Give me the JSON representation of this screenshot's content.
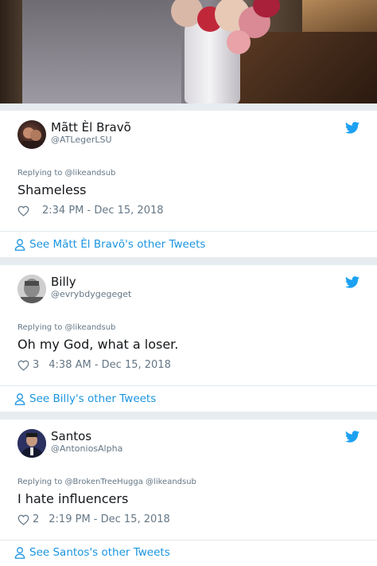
{
  "tweets": [
    {
      "name": "Mãtt Èl Bravõ",
      "handle": "@ATLegerLSU",
      "replying": "Replying to @likeandsub",
      "text": "Shameless",
      "likes": "",
      "time": "2:34 PM - Dec 15, 2018",
      "see_link": "See Mãtt Èl Bravõ's other Tweets"
    },
    {
      "name": "Billy",
      "handle": "@evrybdygegeget",
      "replying": "Replying to @likeandsub",
      "text": "Oh my God, what a loser.",
      "likes": "3",
      "time": "4:38 AM - Dec 15, 2018",
      "see_link": "See Billy's other Tweets"
    },
    {
      "name": "Santos",
      "handle": "@AntoniosAlpha",
      "replying": "Replying to @BrokenTreeHugga @likeandsub",
      "text": "I hate influencers",
      "likes": "2",
      "time": "2:19 PM - Dec 15, 2018",
      "see_link": "See Santos's other Tweets"
    }
  ],
  "icons": {
    "bird": "twitter-bird-icon",
    "heart": "heart-icon",
    "person": "person-icon"
  },
  "colors": {
    "twitter_blue": "#1da1f2",
    "link_blue": "#1b95e0",
    "muted": "#657786",
    "text": "#14171a"
  }
}
